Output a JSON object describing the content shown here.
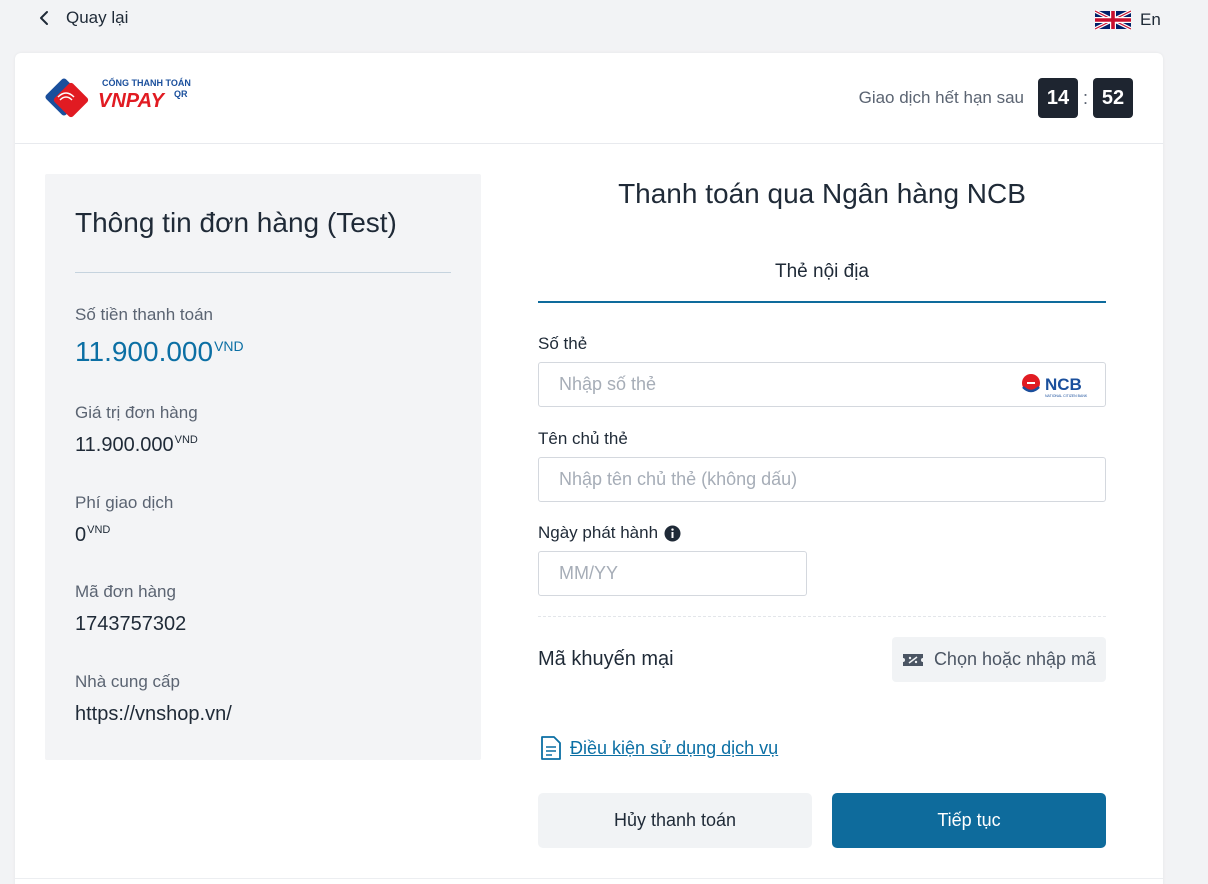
{
  "header": {
    "back_label": "Quay lại",
    "lang_label": "En"
  },
  "logo": {
    "small_text": "CỔNG THANH TOÁN",
    "brand": "VNPAY",
    "brand_suffix": "QR"
  },
  "timer": {
    "label": "Giao dịch hết hạn sau",
    "minutes": "14",
    "separator": ":",
    "seconds": "52"
  },
  "order": {
    "title": "Thông tin đơn hàng (Test)",
    "amount_label": "Số tiền thanh toán",
    "amount_value": "11.900.000",
    "amount_currency": "VND",
    "order_value_label": "Giá trị đơn hàng",
    "order_value": "11.900.000",
    "order_value_currency": "VND",
    "fee_label": "Phí giao dịch",
    "fee_value": "0",
    "fee_currency": "VND",
    "order_id_label": "Mã đơn hàng",
    "order_id": "1743757302",
    "provider_label": "Nhà cung cấp",
    "provider": "https://vnshop.vn/"
  },
  "payment": {
    "title": "Thanh toán qua Ngân hàng NCB",
    "tab_label": "Thẻ nội địa",
    "card_number_label": "Số thẻ",
    "card_number_placeholder": "Nhập số thẻ",
    "bank_logo_text": "NCB",
    "bank_logo_subtext": "NATIONAL CITIZEN BANK",
    "holder_label": "Tên chủ thẻ",
    "holder_placeholder": "Nhập tên chủ thẻ (không dấu)",
    "issue_date_label": "Ngày phát hành",
    "issue_date_placeholder": "MM/YY",
    "promo_label": "Mã khuyến mại",
    "promo_button": "Chọn hoặc nhập mã",
    "terms_link": "Điều kiện sử dụng dịch vụ",
    "cancel_button": "Hủy thanh toán",
    "continue_button": "Tiếp tục"
  },
  "colors": {
    "primary": "#0e6b9c",
    "amount": "#0b6fa4",
    "timer_bg": "#1e2530",
    "panel_bg": "#f3f4f6"
  }
}
